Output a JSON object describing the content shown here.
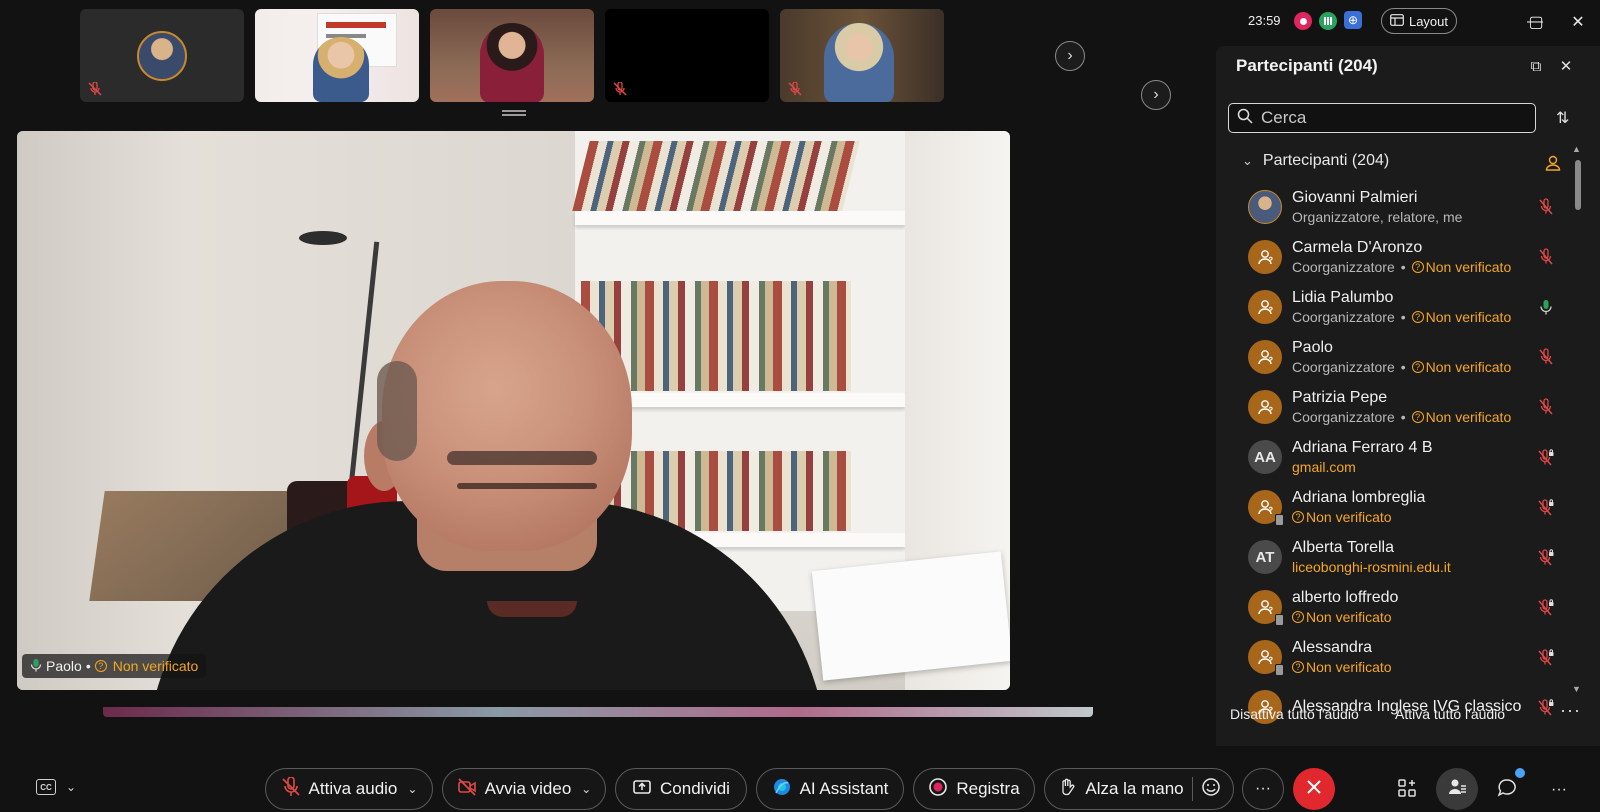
{
  "clock": {
    "time": "23:59"
  },
  "topbar": {
    "layout_label": "Layout"
  },
  "main_video": {
    "name": "Paolo",
    "status": "Non verificato"
  },
  "panel": {
    "title": "Partecipanti (204)",
    "search_placeholder": "Cerca",
    "group_label": "Partecipanti (204)",
    "mute_all": "Disattiva tutto l'audio",
    "unmute_all": "Attiva tutto l'audio",
    "participants": [
      {
        "name": "Giovanni Palmieri",
        "role": "Organizzatore, relatore, me",
        "status": "",
        "avatar": "photo",
        "initials": "",
        "mic": "muted"
      },
      {
        "name": "Carmela D'Aronzo",
        "role": "Coorganizzatore",
        "status": "Non verificato",
        "avatar": "orange",
        "initials": "",
        "mic": "muted"
      },
      {
        "name": "Lidia Palumbo",
        "role": "Coorganizzatore",
        "status": "Non verificato",
        "avatar": "orange",
        "initials": "",
        "mic": "active"
      },
      {
        "name": "Paolo",
        "role": "Coorganizzatore",
        "status": "Non verificato",
        "avatar": "orange",
        "initials": "",
        "mic": "muted"
      },
      {
        "name": "Patrizia Pepe",
        "role": "Coorganizzatore",
        "status": "Non verificato",
        "avatar": "orange",
        "initials": "",
        "mic": "muted"
      },
      {
        "name": "Adriana Ferraro 4 B",
        "role": "",
        "status": "gmail.com",
        "avatar": "grey",
        "initials": "AA",
        "mic": "muted-locked"
      },
      {
        "name": "Adriana lombreglia",
        "role": "",
        "status": "Non verificato",
        "avatar": "orange-device",
        "initials": "",
        "mic": "muted-locked"
      },
      {
        "name": "Alberta Torella",
        "role": "",
        "status": "liceobonghi-rosmini.edu.it",
        "avatar": "grey",
        "initials": "AT",
        "mic": "muted-locked"
      },
      {
        "name": "alberto loffredo",
        "role": "",
        "status": "Non verificato",
        "avatar": "orange-device",
        "initials": "",
        "mic": "muted-locked"
      },
      {
        "name": "Alessandra",
        "role": "",
        "status": "Non verificato",
        "avatar": "orange-device",
        "initials": "",
        "mic": "muted-locked"
      },
      {
        "name": "Alessandra Inglese IVG classico",
        "role": "",
        "status": "",
        "avatar": "orange",
        "initials": "",
        "mic": "muted-locked"
      }
    ]
  },
  "toolbar": {
    "audio": "Attiva audio",
    "video": "Avvia video",
    "share": "Condividi",
    "ai": "AI Assistant",
    "record": "Registra",
    "raise_hand": "Alza la mano",
    "more": "···"
  },
  "colors": {
    "accent_orange": "#f5a623",
    "end_call_red": "#e0282e",
    "mic_active_green": "#2aa35e"
  }
}
